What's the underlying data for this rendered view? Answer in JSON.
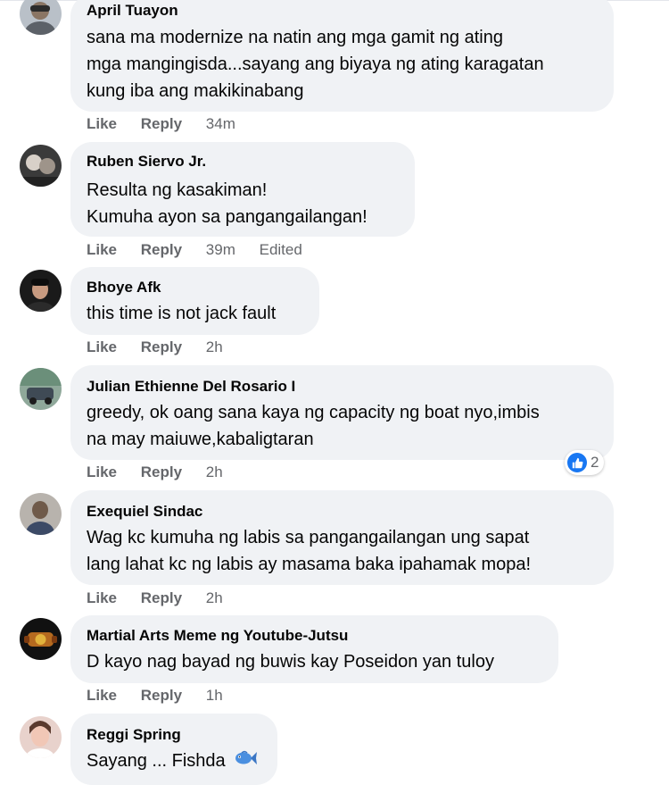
{
  "ui": {
    "like_label": "Like",
    "reply_label": "Reply"
  },
  "colors": {
    "bubble": "#f0f2f5",
    "meta_text": "#65676b",
    "like_reaction": "#1877f2"
  },
  "comments": [
    {
      "author": "April Tuayon",
      "lines": [
        "sana ma modernize na natin ang mga gamit ng ating",
        "mga mangingisda...sayang ang biyaya ng ating karagatan",
        "kung iba ang makikinabang"
      ],
      "time": "34m"
    },
    {
      "author": "Ruben Siervo Jr.",
      "lines": [
        "Resulta ng kasakiman!",
        "Kumuha ayon sa pangangailangan!"
      ],
      "time": "39m",
      "edited": "Edited"
    },
    {
      "author": "Bhoye Afk",
      "lines": [
        "this time is not jack fault"
      ],
      "time": "2h"
    },
    {
      "author": "Julian Ethienne Del Rosario I",
      "lines": [
        "greedy, ok oang sana kaya ng capacity ng boat nyo,imbis",
        "na may maiuwe,kabaligtaran"
      ],
      "time": "2h",
      "reaction_count": "2",
      "reaction_icon": "thumbs-up-icon"
    },
    {
      "author": "Exequiel Sindac",
      "lines": [
        "Wag kc kumuha ng labis sa pangangailangan ung sapat",
        "lang lahat kc ng labis ay masama baka ipahamak mopa!"
      ],
      "time": "2h"
    },
    {
      "author": "Martial Arts Meme ng Youtube-Jutsu",
      "lines": [
        "D kayo nag bayad ng buwis kay Poseidon yan tuloy"
      ],
      "time": "1h"
    },
    {
      "author": "Reggi Spring",
      "lines": [
        "Sayang ... Fishda"
      ],
      "emoji": "fish-emoji-icon"
    }
  ]
}
